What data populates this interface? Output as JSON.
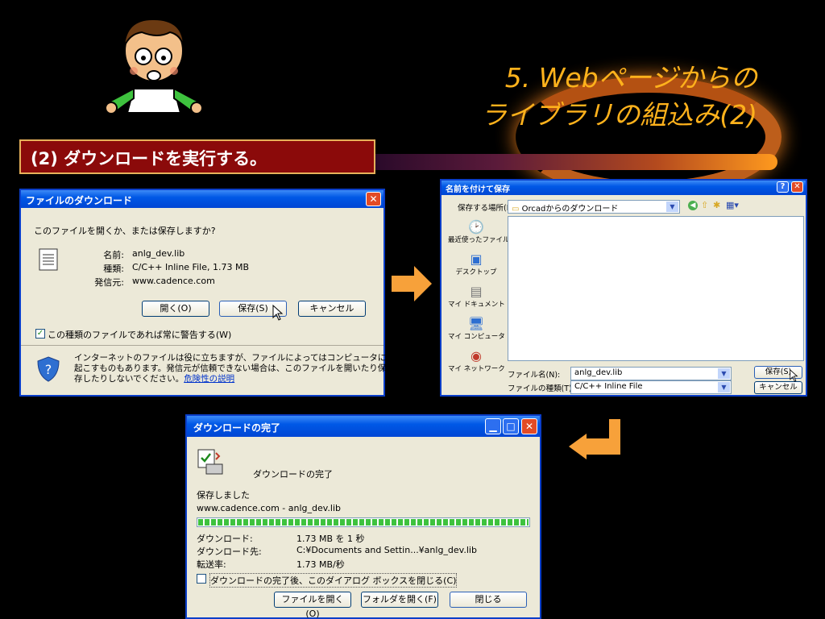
{
  "slide": {
    "title_line1": "5. Webページからの",
    "title_line2": "ライブラリの組込み(2)",
    "step": "(2) ダウンロードを実行する。"
  },
  "dialog1": {
    "title": "ファイルのダウンロード",
    "question": "このファイルを開くか、または保存しますか?",
    "name_label": "名前:",
    "name_value": "anlg_dev.lib",
    "type_label": "種類:",
    "type_value": "C/C++ Inline File, 1.73 MB",
    "from_label": "発信元:",
    "from_value": "www.cadence.com",
    "open_btn": "開く(O)",
    "save_btn": "保存(S)",
    "cancel_btn": "キャンセル",
    "checkbox_label": "この種類のファイルであれば常に警告する(W)",
    "warning_line1": "インターネットのファイルは役に立ちますが、ファイルによってはコンピュータに問題を",
    "warning_line2": "起こすものもあります。発信元が信頼できない場合は、このファイルを開いたり保",
    "warning_line3": "存したりしないでください。",
    "warning_link": "危険性の説明"
  },
  "dialog2": {
    "title": "名前を付けて保存",
    "location_label": "保存する場所(I):",
    "location_value": "Orcadからのダウンロード",
    "places": [
      "最近使ったファイル",
      "デスクトップ",
      "マイ ドキュメント",
      "マイ コンピュータ",
      "マイ ネットワーク"
    ],
    "filename_label": "ファイル名(N):",
    "filename_value": "anlg_dev.lib",
    "filetype_label": "ファイルの種類(T):",
    "filetype_value": "C/C++ Inline File",
    "save_btn": "保存(S)",
    "cancel_btn": "キャンセル"
  },
  "dialog3": {
    "title": "ダウンロードの完了",
    "heading": "ダウンロードの完了",
    "saved": "保存しました",
    "source": "www.cadence.com - anlg_dev.lib",
    "progress": 1.0,
    "dl_label": "ダウンロード:",
    "dl_value": "1.73 MB を 1 秒",
    "dest_label": "ダウンロード先:",
    "dest_value": "C:¥Documents and Settin...¥anlg_dev.lib",
    "rate_label": "転送率:",
    "rate_value": "1.73 MB/秒",
    "close_after": "ダウンロードの完了後、このダイアログ ボックスを閉じる(C)",
    "open_file_btn": "ファイルを開く(O)",
    "open_folder_btn": "フォルダを開く(F)",
    "close_btn": "閉じる"
  },
  "colors": {
    "title": "#ffb21c",
    "step_bg": "#8b0a0a",
    "xp_title": "#0058e6",
    "arrow": "#f7a13a"
  }
}
